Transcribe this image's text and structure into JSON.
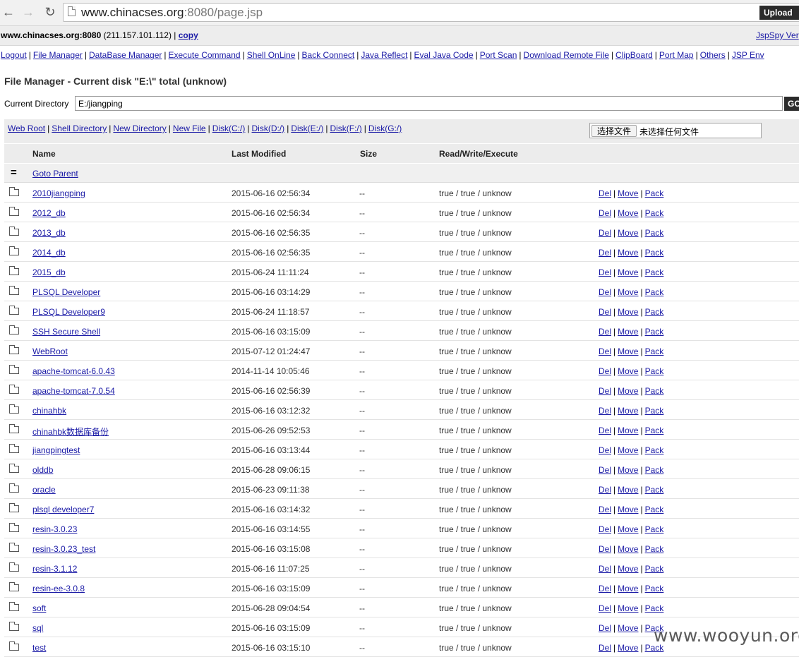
{
  "browser": {
    "url_host": "www.chinacses.org",
    "url_rest": ":8080/page.jsp"
  },
  "infobar": {
    "host": "www.chinacses.org:8080",
    "ip": "(211.157.101.112) |",
    "copy_label": "copy",
    "brand": "JspSpy Ver"
  },
  "nav": [
    "Logout",
    "File Manager",
    "DataBase Manager",
    "Execute Command",
    "Shell OnLine",
    "Back Connect",
    "Java Reflect",
    "Eval Java Code",
    "Port Scan",
    "Download Remote File",
    "ClipBoard",
    "Port Map",
    "Others",
    "JSP Env"
  ],
  "title": "File Manager - Current disk \"E:\\\" total (unknow)",
  "current_dir": {
    "label": "Current Directory",
    "value": "E:/jiangping",
    "go_label": "GO"
  },
  "quick_links": [
    "Web Root",
    "Shell Directory",
    "New Directory",
    "New File",
    "Disk(C:/)",
    "Disk(D:/)",
    "Disk(E:/)",
    "Disk(F:/)",
    "Disk(G:/)"
  ],
  "upload": {
    "choose_label": "选择文件",
    "no_file_label": "未选择任何文件",
    "upload_label": "Upload"
  },
  "table": {
    "headers": {
      "name": "Name",
      "modified": "Last Modified",
      "size": "Size",
      "rwe": "Read/Write/Execute"
    },
    "parent_icon": "=",
    "parent_label": "Goto Parent",
    "actions": {
      "del": "Del",
      "move": "Move",
      "pack": "Pack"
    },
    "rows": [
      {
        "name": "2010jiangping",
        "modified": "2015-06-16 02:56:34",
        "size": "--",
        "perm": "true / true / unknow"
      },
      {
        "name": "2012_db",
        "modified": "2015-06-16 02:56:34",
        "size": "--",
        "perm": "true / true / unknow"
      },
      {
        "name": "2013_db",
        "modified": "2015-06-16 02:56:35",
        "size": "--",
        "perm": "true / true / unknow"
      },
      {
        "name": "2014_db",
        "modified": "2015-06-16 02:56:35",
        "size": "--",
        "perm": "true / true / unknow"
      },
      {
        "name": "2015_db",
        "modified": "2015-06-24 11:11:24",
        "size": "--",
        "perm": "true / true / unknow"
      },
      {
        "name": "PLSQL Developer",
        "modified": "2015-06-16 03:14:29",
        "size": "--",
        "perm": "true / true / unknow"
      },
      {
        "name": "PLSQL Developer9",
        "modified": "2015-06-24 11:18:57",
        "size": "--",
        "perm": "true / true / unknow"
      },
      {
        "name": "SSH Secure Shell",
        "modified": "2015-06-16 03:15:09",
        "size": "--",
        "perm": "true / true / unknow"
      },
      {
        "name": "WebRoot",
        "modified": "2015-07-12 01:24:47",
        "size": "--",
        "perm": "true / true / unknow"
      },
      {
        "name": "apache-tomcat-6.0.43",
        "modified": "2014-11-14 10:05:46",
        "size": "--",
        "perm": "true / true / unknow"
      },
      {
        "name": "apache-tomcat-7.0.54",
        "modified": "2015-06-16 02:56:39",
        "size": "--",
        "perm": "true / true / unknow"
      },
      {
        "name": "chinahbk",
        "modified": "2015-06-16 03:12:32",
        "size": "--",
        "perm": "true / true / unknow"
      },
      {
        "name": "chinahbk数据库备份",
        "modified": "2015-06-26 09:52:53",
        "size": "--",
        "perm": "true / true / unknow"
      },
      {
        "name": "jiangpingtest",
        "modified": "2015-06-16 03:13:44",
        "size": "--",
        "perm": "true / true / unknow"
      },
      {
        "name": "olddb",
        "modified": "2015-06-28 09:06:15",
        "size": "--",
        "perm": "true / true / unknow"
      },
      {
        "name": "oracle",
        "modified": "2015-06-23 09:11:38",
        "size": "--",
        "perm": "true / true / unknow"
      },
      {
        "name": "plsql developer7",
        "modified": "2015-06-16 03:14:32",
        "size": "--",
        "perm": "true / true / unknow"
      },
      {
        "name": "resin-3.0.23",
        "modified": "2015-06-16 03:14:55",
        "size": "--",
        "perm": "true / true / unknow"
      },
      {
        "name": "resin-3.0.23_test",
        "modified": "2015-06-16 03:15:08",
        "size": "--",
        "perm": "true / true / unknow"
      },
      {
        "name": "resin-3.1.12",
        "modified": "2015-06-16 11:07:25",
        "size": "--",
        "perm": "true / true / unknow"
      },
      {
        "name": "resin-ee-3.0.8",
        "modified": "2015-06-16 03:15:09",
        "size": "--",
        "perm": "true / true / unknow"
      },
      {
        "name": "soft",
        "modified": "2015-06-28 09:04:54",
        "size": "--",
        "perm": "true / true / unknow"
      },
      {
        "name": "sql",
        "modified": "2015-06-16 03:15:09",
        "size": "--",
        "perm": "true / true / unknow"
      },
      {
        "name": "test",
        "modified": "2015-06-16 03:15:10",
        "size": "--",
        "perm": "true / true / unknow"
      }
    ]
  },
  "watermark": "www.wooyun.org"
}
